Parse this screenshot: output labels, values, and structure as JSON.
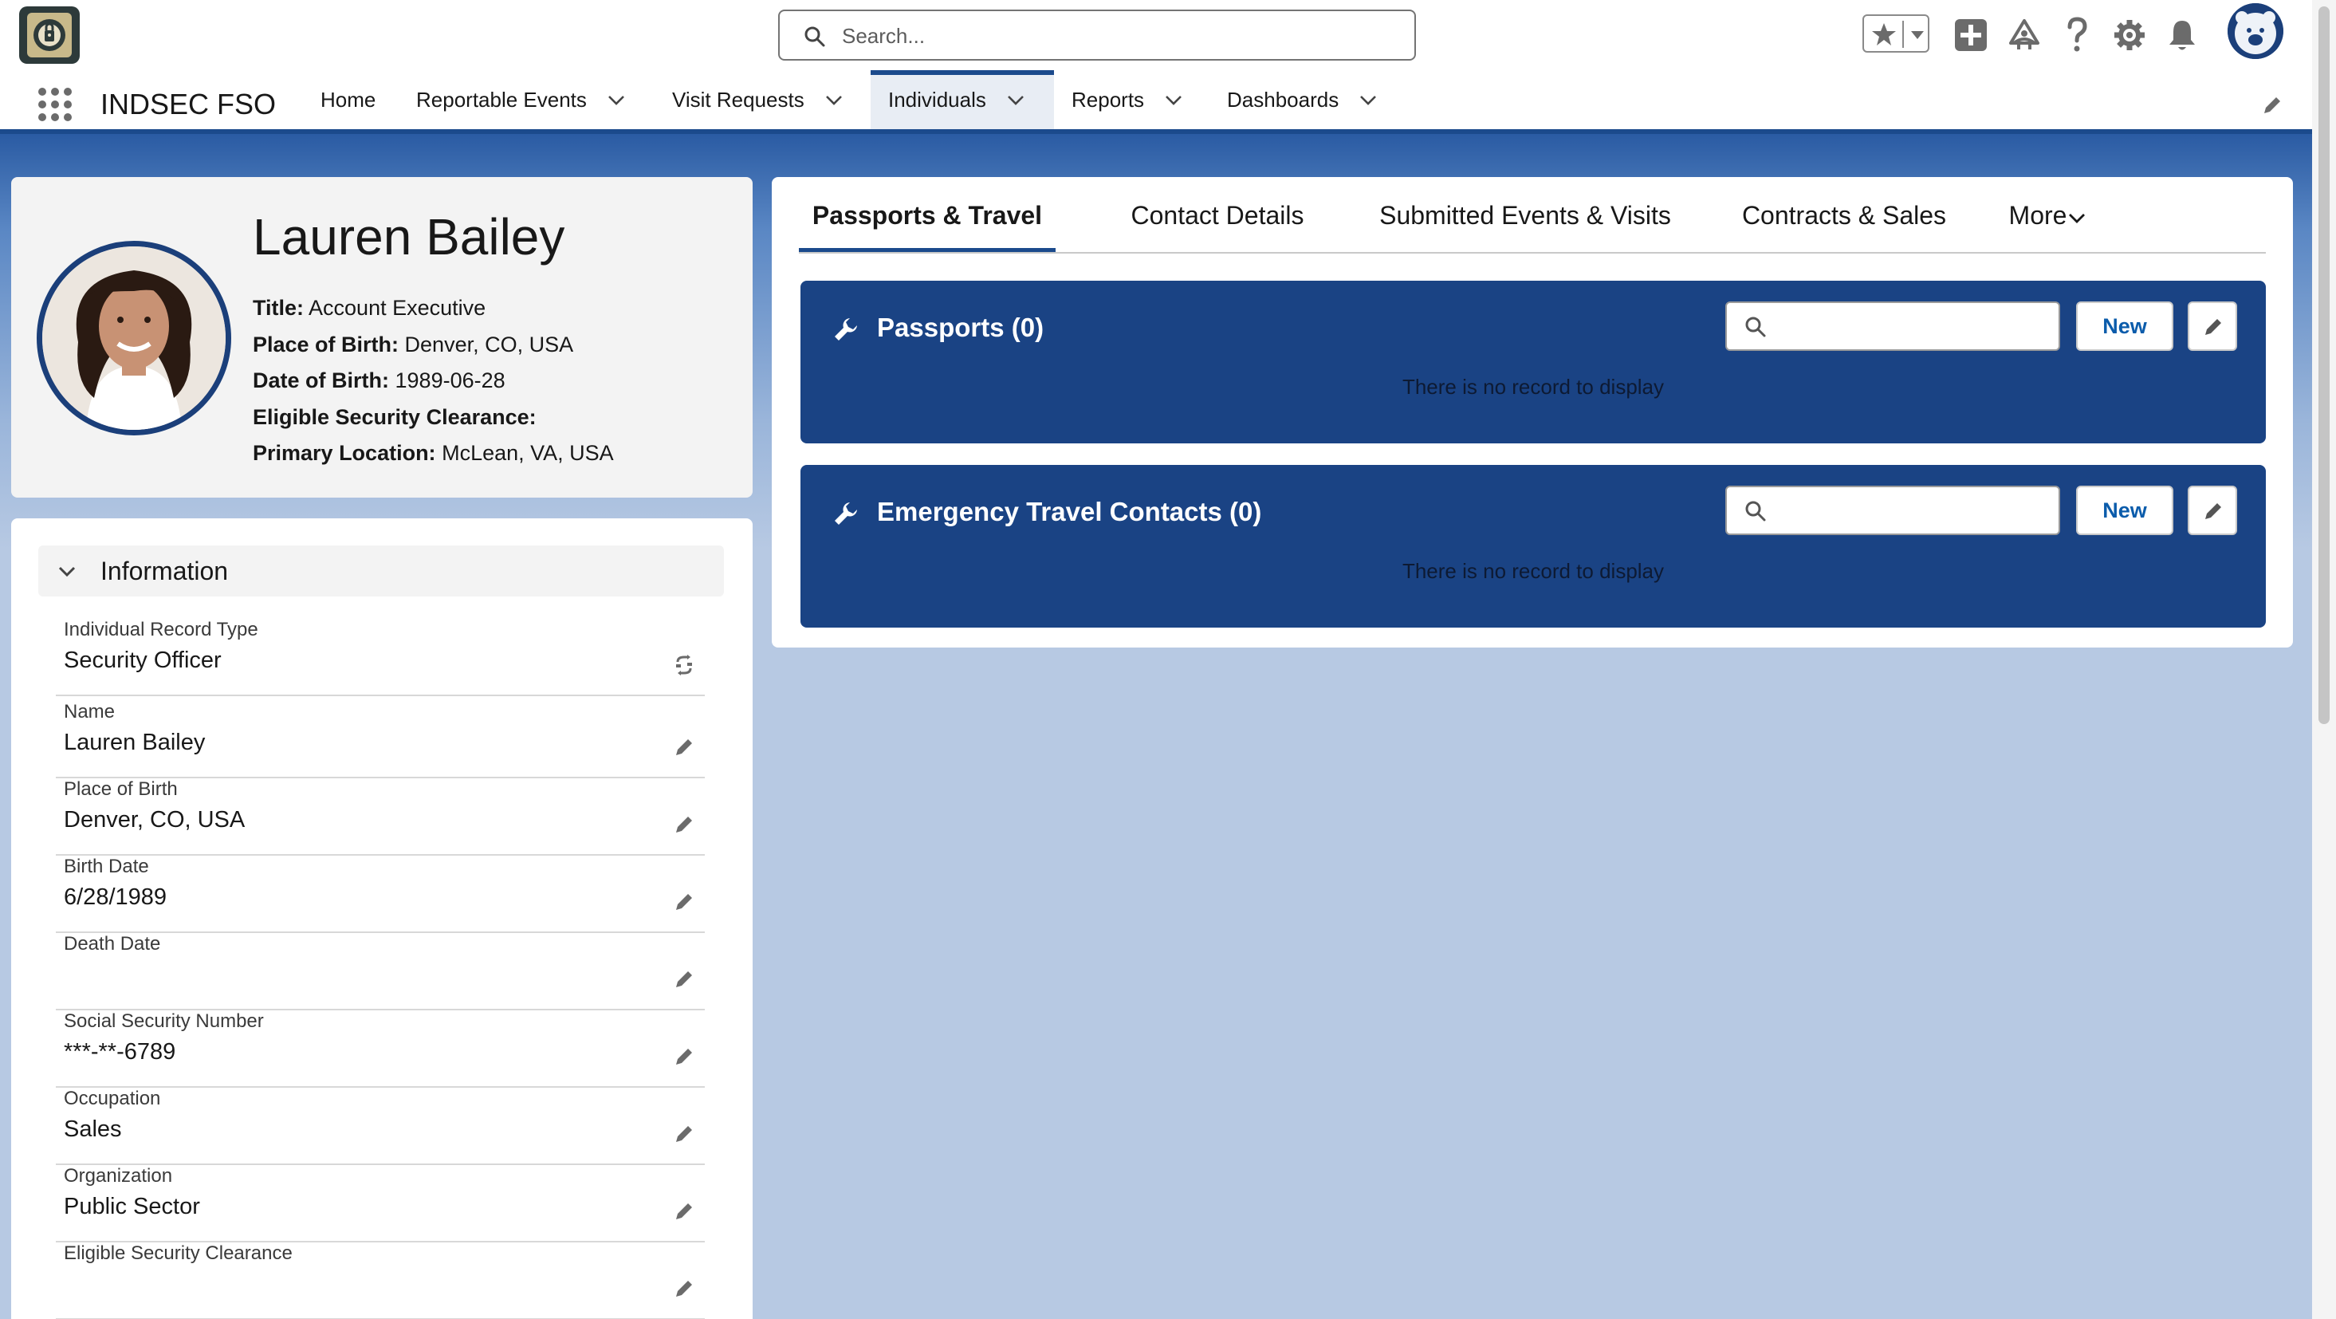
{
  "header": {
    "search_placeholder": "Search...",
    "icons": [
      "favorites-star-icon",
      "add-icon",
      "trailhead-icon",
      "help-icon",
      "setup-gear-icon",
      "notifications-bell-icon",
      "user-avatar"
    ]
  },
  "nav": {
    "app_name": "INDSEC FSO",
    "items": [
      {
        "label": "Home"
      },
      {
        "label": "Reportable Events"
      },
      {
        "label": "Visit Requests"
      },
      {
        "label": "Individuals"
      },
      {
        "label": "Reports"
      },
      {
        "label": "Dashboards"
      }
    ],
    "active": "Individuals"
  },
  "profile": {
    "name": "Lauren Bailey",
    "title_label": "Title:",
    "title": "Account Executive",
    "pob_label": "Place of Birth:",
    "pob": "Denver, CO, USA",
    "dob_label": "Date of Birth:",
    "dob": "1989-06-28",
    "clearance_label": "Eligible Security Clearance:",
    "clearance": "",
    "location_label": "Primary Location:",
    "location": "McLean, VA, USA"
  },
  "info": {
    "section_title": "Information",
    "fields": [
      {
        "label": "Individual Record Type",
        "value": "Security Officer"
      },
      {
        "label": "Name",
        "value": "Lauren Bailey"
      },
      {
        "label": "Place of Birth",
        "value": "Denver, CO, USA"
      },
      {
        "label": "Birth Date",
        "value": "6/28/1989"
      },
      {
        "label": "Death Date",
        "value": ""
      },
      {
        "label": "Social Security Number",
        "value": "***-**-6789"
      },
      {
        "label": "Occupation",
        "value": "Sales"
      },
      {
        "label": "Organization",
        "value": "Public Sector"
      },
      {
        "label": "Eligible Security Clearance",
        "value": ""
      }
    ]
  },
  "tabs": [
    {
      "label": "Passports & Travel"
    },
    {
      "label": "Contact Details"
    },
    {
      "label": "Submitted Events & Visits"
    },
    {
      "label": "Contracts & Sales"
    },
    {
      "label": "More"
    }
  ],
  "active_tab": "Passports & Travel",
  "related_lists": [
    {
      "title": "Passports (0)",
      "new_label": "New",
      "empty_text": "There is no record to display"
    },
    {
      "title": "Emergency Travel Contacts (0)",
      "new_label": "New",
      "empty_text": "There is no record to display"
    }
  ],
  "colors": {
    "brand_navy": "#1b4a8c",
    "related_card_bg": "#1a4384",
    "link_blue": "#0b5cab",
    "page_bg": "#b7c9e3"
  }
}
